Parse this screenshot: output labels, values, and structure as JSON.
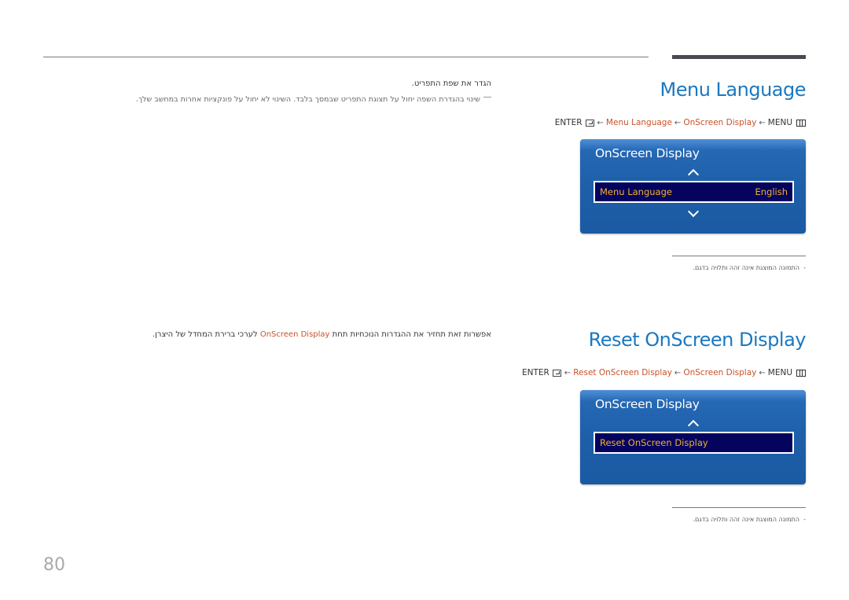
{
  "sections": [
    {
      "title": "Menu Language",
      "path": {
        "enter": "ENTER",
        "arrow": "←",
        "item": "Menu Language",
        "parent": "OnScreen Display",
        "menu": "MENU"
      },
      "description": "הגדר את שפת התפריט.",
      "subnote": "שינוי בהגדרת השפה יחול על תצוגת התפריט שבמסך בלבד. השינוי לא יחול על פונקציות אחרות במחשב שלך.",
      "osd": {
        "title": "OnScreen Display",
        "row_label": "Menu Language",
        "row_value": "English"
      },
      "footnote": "התמונה המוצגת אינה זהה ותלויה בדגם.",
      "footnote_bullet": "-"
    },
    {
      "title": "Reset OnScreen Display",
      "path": {
        "enter": "ENTER",
        "arrow": "←",
        "item": "Reset OnScreen Display",
        "parent": "OnScreen Display",
        "menu": "MENU"
      },
      "description_pre": "אפשרות זאת תחזיר את ההגדרות הנוכחיות תחת",
      "description_hl": "OnScreen Display",
      "description_post": "לערכי ברירת המחדל של היצרן.",
      "osd": {
        "title": "OnScreen Display",
        "row_label": "Reset OnScreen Display"
      },
      "footnote": "התמונה המוצגת אינה זהה ותלויה בדגם.",
      "footnote_bullet": "-"
    }
  ],
  "page_number": "80",
  "colors": {
    "title_blue": "#1b78c0",
    "link_orange": "#c8522a",
    "osd_blue": "#1e5fa9",
    "osd_row_bg": "#04035e",
    "osd_row_text": "#f0b030"
  }
}
